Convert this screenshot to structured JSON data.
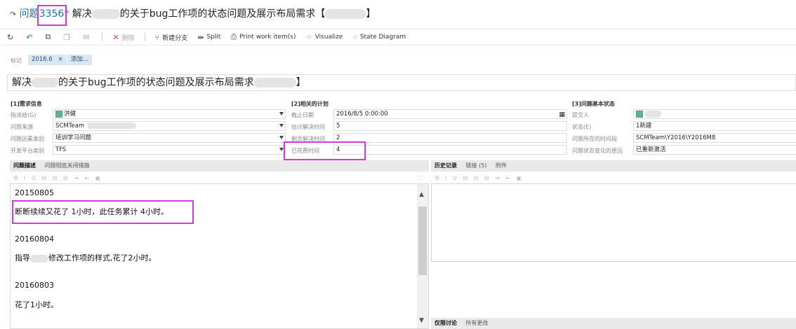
{
  "header": {
    "type_label": "问题",
    "id": "3356",
    "dirty_mark": "*",
    "title_prefix": "解决",
    "title_middle": "的关于bug工作项的状态问题及展示布局需求【",
    "title_suffix": "】"
  },
  "toolbar": {
    "items": [
      {
        "icon": "refresh-icon",
        "label": ""
      },
      {
        "icon": "undo-icon",
        "label": ""
      },
      {
        "icon": "copy-template-icon",
        "label": ""
      },
      {
        "icon": "clone-icon",
        "label": ""
      },
      {
        "icon": "email-icon",
        "label": ""
      },
      {
        "icon": "delete-icon",
        "label": "删除"
      },
      {
        "icon": "branch-icon",
        "label": "新建分支"
      },
      {
        "icon": "split-icon",
        "label": "Split"
      },
      {
        "icon": "print-icon",
        "label": "Print work item(s)"
      },
      {
        "icon": "visualize-icon",
        "label": "Visualize"
      },
      {
        "icon": "state-diagram-icon",
        "label": "State Diagram"
      }
    ]
  },
  "tags": {
    "label": "标记",
    "items": [
      "2016.6"
    ],
    "remove_glyph": "×",
    "add_label": "添加..."
  },
  "title_field": {
    "prefix": "解决",
    "middle": "的关于bug工作项的状态问题及展示布局需求",
    "suffix": "】"
  },
  "sections": {
    "s1": {
      "title": "[1]需求信息",
      "fields": [
        {
          "label": "指派给(G)",
          "value": "洪健"
        },
        {
          "label": "问题来源",
          "value": "SCMTeam"
        },
        {
          "label": "问题因素类别",
          "value": "培训学习问题"
        },
        {
          "label": "开发平台类别",
          "value": "TFS"
        }
      ]
    },
    "s2": {
      "title": "[2]相关的计划",
      "fields": [
        {
          "label": "截止日期",
          "value": "2016/8/5 0:00:00"
        },
        {
          "label": "估计解决时间",
          "value": "5"
        },
        {
          "label": "剩余解决时间",
          "value": "2"
        },
        {
          "label": "已花费时间",
          "value": "4"
        }
      ]
    },
    "s3": {
      "title": "[3]问题基本状态",
      "fields": [
        {
          "label": "提交人",
          "value": ""
        },
        {
          "label": "状态(E)",
          "value": "1新建"
        },
        {
          "label": "问题所在的时间段",
          "value": "SCMTeam\\Y2016\\Y2016M8"
        },
        {
          "label": "问题状态变化的原因",
          "value": "已重新激活"
        }
      ]
    }
  },
  "left_panel": {
    "tabs": [
      "问题描述",
      "问题彻底关闭措施"
    ],
    "toolbar_glyphs": "B I U",
    "content": {
      "date1": "20150805",
      "line1": "断断续续又花了 1小时，此任务累计 4小时。",
      "date2": "20160804",
      "line2_prefix": "指导",
      "line2_suffix": "修改工作项的样式,花了2小时。",
      "date3": "20160803",
      "line3": "花了1小时。"
    },
    "scroll_up": "▲",
    "scroll_down": "▼"
  },
  "right_panel": {
    "tabs": [
      "历史记录",
      "链接 (5)",
      "附件"
    ],
    "toolbar_glyphs": "B I U"
  },
  "bottom_panel": {
    "tabs": [
      "仅限讨论",
      "所有更改"
    ]
  }
}
